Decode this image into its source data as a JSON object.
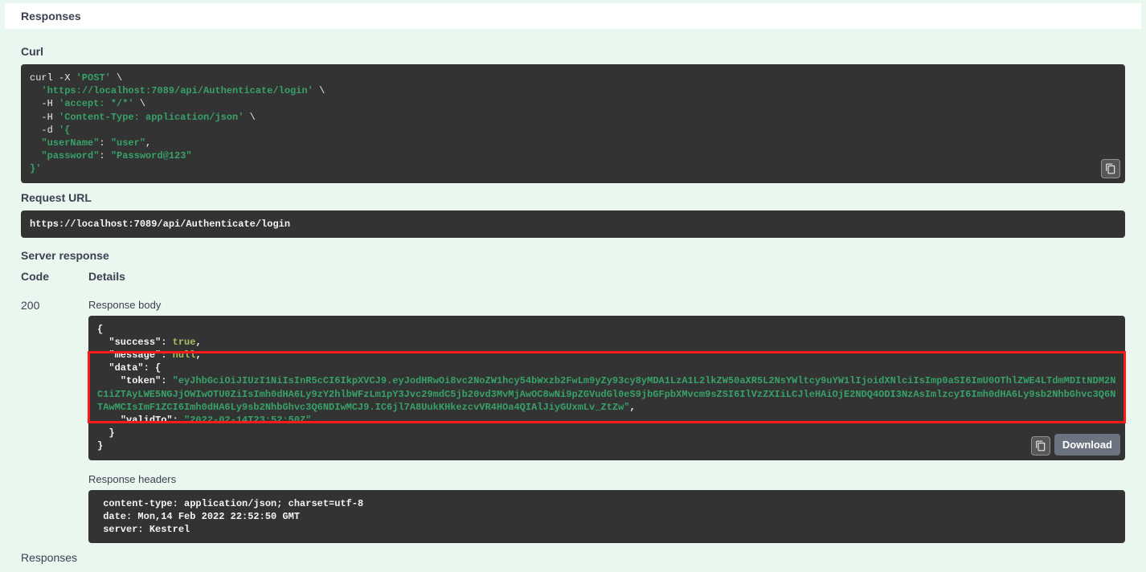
{
  "headers": {
    "responses_top": "Responses",
    "curl": "Curl",
    "request_url": "Request URL",
    "server_response": "Server response",
    "code_col": "Code",
    "details_col": "Details",
    "response_body": "Response body",
    "response_headers": "Response headers",
    "responses_bottom": "Responses"
  },
  "curl": {
    "line1_pre": "curl -X ",
    "line1_method": "'POST'",
    "line1_post": " \\",
    "line2_url": "  'https://localhost:7089/api/Authenticate/login'",
    "line2_post": " \\",
    "line3_pre": "  -H ",
    "line3_hdr": "'accept: */*'",
    "line3_post": " \\",
    "line4_pre": "  -H ",
    "line4_hdr": "'Content-Type: application/json'",
    "line4_post": " \\",
    "line5_pre": "  -d ",
    "line5_body": "'{",
    "line6_key": "  \"userName\"",
    "line6_sep": ": ",
    "line6_val": "\"user\"",
    "line6_end": ",",
    "line7_key": "  \"password\"",
    "line7_sep": ": ",
    "line7_val": "\"Password@123\"",
    "line8": "}'"
  },
  "request_url_value": "https://localhost:7089/api/Authenticate/login",
  "status_code": "200",
  "response_body": {
    "open": "{",
    "k_success": "  \"success\"",
    "v_success": "true",
    "k_message": "  \"message\"",
    "v_message": "null",
    "k_data": "  \"data\"",
    "v_data_open": "{",
    "k_token": "    \"token\"",
    "v_token": "\"eyJhbGciOiJIUzI1NiIsInR5cCI6IkpXVCJ9.eyJodHRwOi8vc2NoZW1hcy54bWxzb2FwLm9yZy93cy8yMDA1LzA1L2lkZW50aXR5L2NsYWltcy9uYW1lIjoidXNlciIsImp0aSI6ImU0OThlZWE4LTdmMDItNDM2NC1iZTAyLWE5NGJjOWIwOTU0ZiIsImh0dHA6Ly9zY2hlbWFzLm1pY3Jvc29mdC5jb20vd3MvMjAwOC8wNi9pZGVudGl0eS9jbGFpbXMvcm9sZSI6IlVzZXIiLCJleHAiOjE2NDQ4ODI3NzAsImlzcyI6Imh0dHA6Ly9sb2NhbGhvc3Q6NTAwMCIsImF1ZCI6Imh0dHA6Ly9sb2NhbGhvc3Q6NDIwMCJ9.IC6jl7A8UukKHkezcvVR4HOa4QIAlJiyGUxmLv_ZtZw\"",
    "k_validto": "    \"validTo\"",
    "v_validto": "\"2022-02-14T23:52:50Z\"",
    "data_close": "  }",
    "close": "}"
  },
  "response_headers_text": " content-type: application/json; charset=utf-8 \n date: Mon,14 Feb 2022 22:52:50 GMT \n server: Kestrel ",
  "buttons": {
    "download": "Download"
  }
}
